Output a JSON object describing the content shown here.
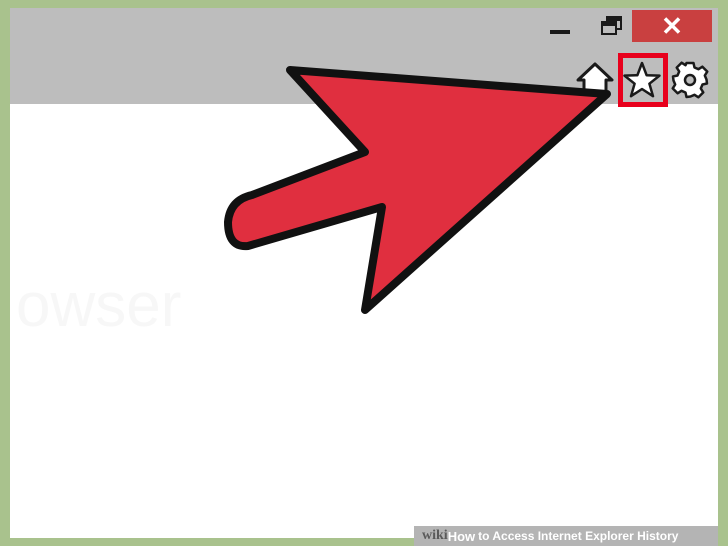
{
  "window": {
    "close_label": "✕",
    "page_text_fragment": "owser"
  },
  "toolbar": {
    "icons": [
      "home-icon",
      "star-icon",
      "gear-icon"
    ],
    "highlighted_icon": "star-icon"
  },
  "annotation": {
    "arrow_color": "#e02f3f",
    "highlight_color": "#e8001c"
  },
  "footer": {
    "wiki": "wiki",
    "how": "How",
    "title": "to Access Internet Explorer History"
  }
}
